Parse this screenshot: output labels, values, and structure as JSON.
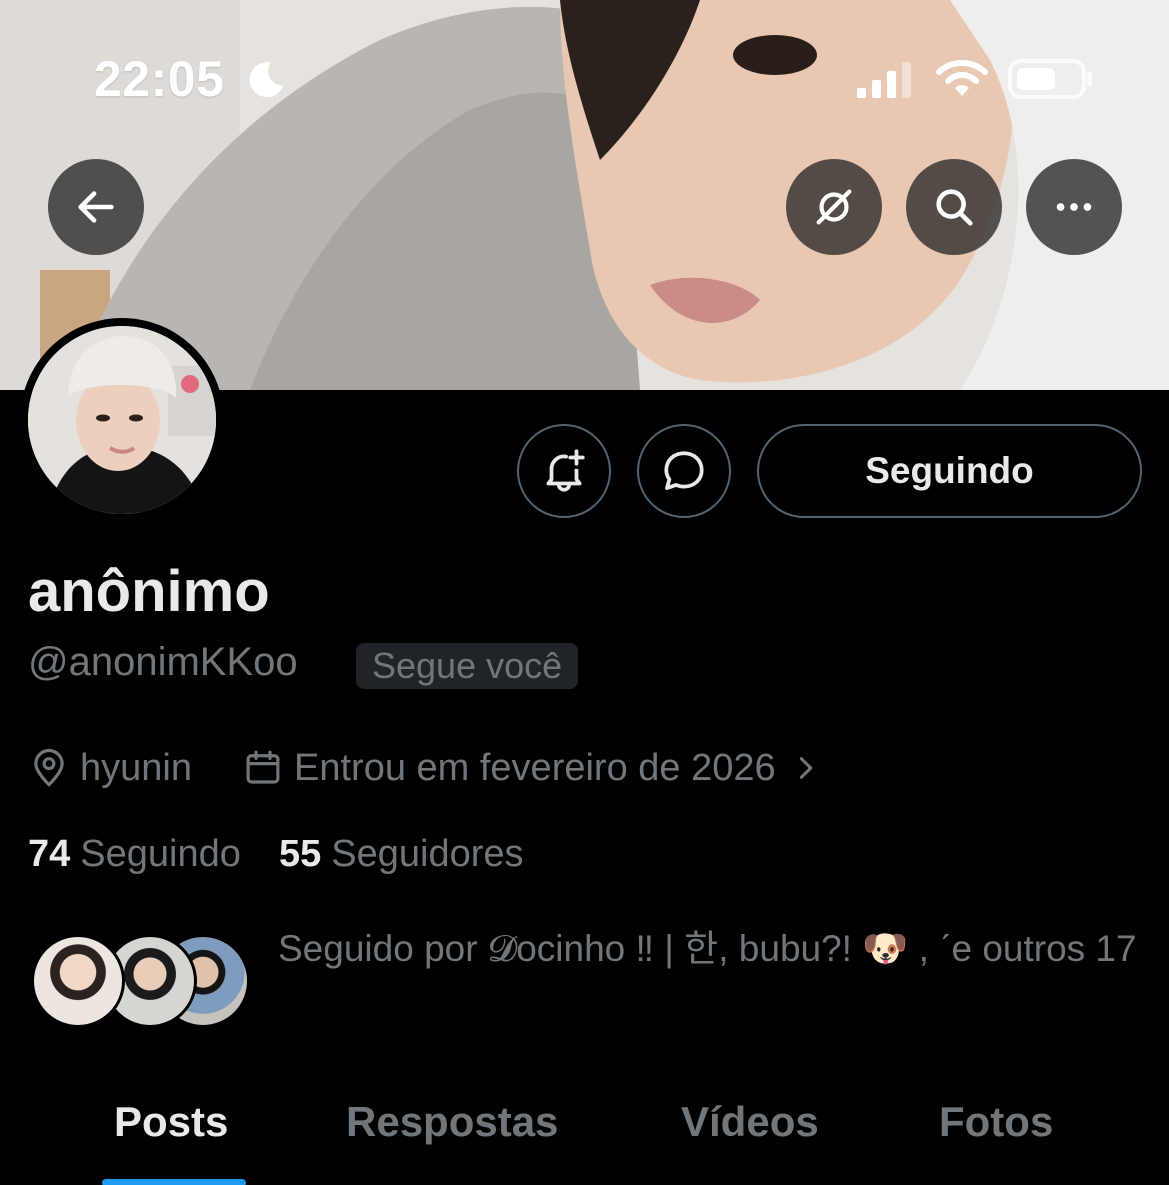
{
  "status_bar": {
    "time": "22:05",
    "focus_icon": "moon-icon",
    "signal_icon": "signal-icon",
    "wifi_icon": "wifi-icon",
    "battery_icon": "battery-icon"
  },
  "banner": {
    "back_icon": "arrow-left-icon",
    "grok_icon": "grok-icon",
    "search_icon": "search-icon",
    "more_icon": "more-horizontal-icon"
  },
  "actions": {
    "notify_icon": "bell-plus-icon",
    "message_icon": "message-icon",
    "following_label": "Seguindo"
  },
  "profile": {
    "display_name": "anônimo",
    "handle": "@anonimKKoo",
    "follows_you_badge": "Segue você",
    "location": "hyunin",
    "joined": "Entrou em fevereiro de 2026",
    "following_count": "74",
    "following_label": "Seguindo",
    "followers_count": "55",
    "followers_label": "Seguidores",
    "followed_by": "Seguido por 𝓓ocinho ‼︎ | 한, bubu?! 🐶 , ˊe outros 17"
  },
  "tabs": [
    {
      "label": "Posts",
      "active": true
    },
    {
      "label": "Respostas",
      "active": false
    },
    {
      "label": "Vídeos",
      "active": false
    },
    {
      "label": "Fotos",
      "active": false
    }
  ],
  "colors": {
    "background": "#000000",
    "text_primary": "#e7e9ea",
    "text_secondary": "#71767b",
    "border": "#536471",
    "accent": "#1d9bf0"
  }
}
